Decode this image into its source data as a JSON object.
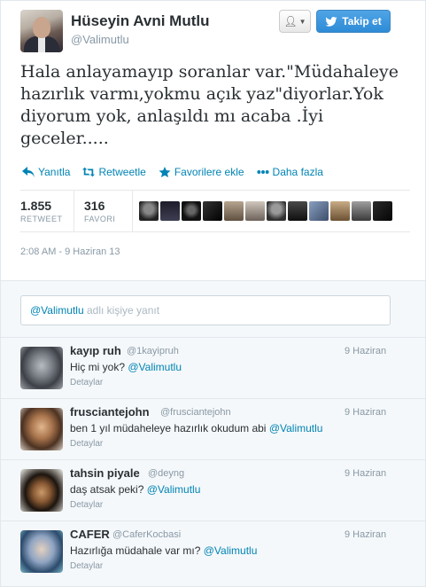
{
  "header": {
    "fullname": "Hüseyin Avni Mutlu",
    "username": "@Valimutlu",
    "follow_label": "Takip et"
  },
  "tweet": {
    "text": "Hala anlayamayıp soranlar var.\"Müdahaleye hazırlık varmı,yokmu açık yaz\"diyorlar.Yok diyorum yok, anlaşıldı mı acaba .İyi geceler.....",
    "actions": {
      "reply": "Yanıtla",
      "retweet": "Retweetle",
      "favorite": "Favorilere ekle",
      "more": "Daha fazla"
    },
    "stats": {
      "retweet_count": "1.855",
      "retweet_label": "RETWEET",
      "fav_count": "316",
      "fav_label": "FAVORI"
    },
    "timestamp": "2:08 AM - 9 Haziran 13"
  },
  "reply_box": {
    "mention": "@Valimutlu",
    "placeholder": "adlı kişiye yanıt"
  },
  "replies": [
    {
      "name": "kayıp ruh",
      "handle": "@1kayipruh",
      "date": "9 Haziran",
      "text": "Hiç mi yok?",
      "mention": "@Valimutlu",
      "details": "Detaylar"
    },
    {
      "name": "frusciantejohn",
      "handle": "@frusciantejohn",
      "date": "9 Haziran",
      "text": "ben 1 yıl müdaheleye hazırlık okudum abi",
      "mention": "@Valimutlu",
      "details": "Detaylar"
    },
    {
      "name": "tahsin piyale",
      "handle": "@deyng",
      "date": "9 Haziran",
      "text": "daş atsak peki?",
      "mention": "@Valimutlu",
      "details": "Detaylar"
    },
    {
      "name": "CAFER",
      "handle": "@CaferKocbasi",
      "date": "9 Haziran",
      "text": "Hazırlığa müdahale var mı?",
      "mention": "@Valimutlu",
      "details": "Detaylar"
    }
  ],
  "colors": {
    "link": "#0084b4",
    "follow_button": "#2e8bd6",
    "muted": "#8899a6"
  }
}
